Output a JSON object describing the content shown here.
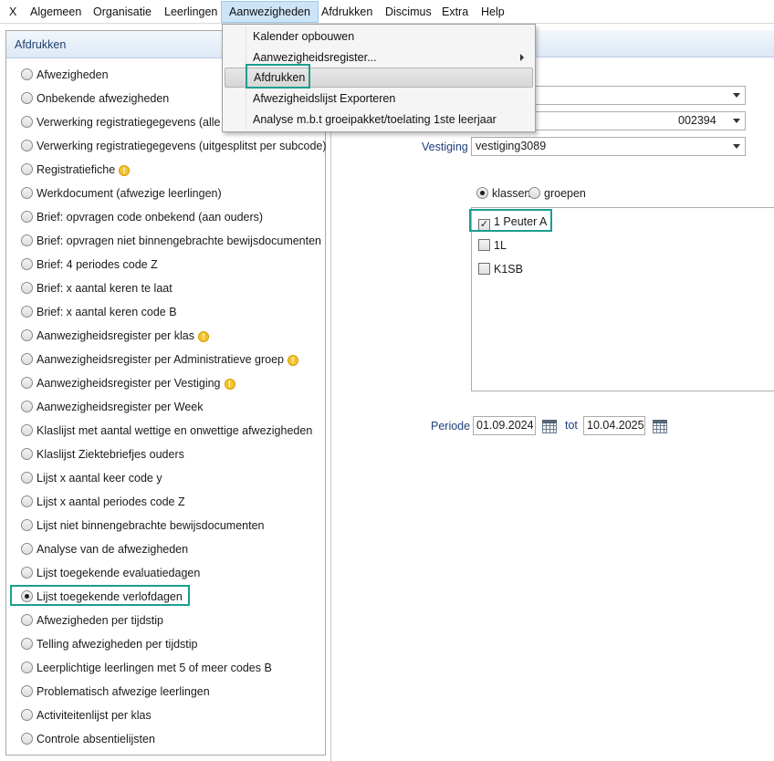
{
  "menubar": {
    "items": [
      "X",
      "Algemeen",
      "Organisatie",
      "Leerlingen",
      "Aanwezigheden",
      "Afdrukken",
      "Discimus",
      "Extra",
      "Help"
    ],
    "active": "Aanwezigheden"
  },
  "dropdown": {
    "items": [
      {
        "label": "Kalender opbouwen",
        "submenu": false
      },
      {
        "label": "Aanwezigheidsregister...",
        "submenu": true
      },
      {
        "label": "Afdrukken",
        "submenu": false,
        "hovered": true
      },
      {
        "label": "Afwezigheidslijst Exporteren",
        "submenu": false
      },
      {
        "label": "Analyse m.b.t groeipakket/toelating 1ste leerjaar",
        "submenu": false
      }
    ]
  },
  "left_panel": {
    "title": "Afdrukken",
    "options": [
      {
        "label": "Afwezigheden",
        "warn": false
      },
      {
        "label": "Onbekende afwezigheden",
        "warn": false
      },
      {
        "label": "Verwerking registratiegegevens (alle co",
        "warn": false
      },
      {
        "label": "Verwerking registratiegegevens (uitgesplitst per subcode)",
        "warn": false
      },
      {
        "label": "Registratiefiche",
        "warn": true
      },
      {
        "label": "Werkdocument (afwezige leerlingen)",
        "warn": false
      },
      {
        "label": "Brief: opvragen code onbekend (aan ouders)",
        "warn": false
      },
      {
        "label": "Brief: opvragen niet binnengebrachte bewijsdocumenten",
        "warn": false
      },
      {
        "label": "Brief: 4 periodes code Z",
        "warn": false
      },
      {
        "label": "Brief: x aantal keren te laat",
        "warn": false
      },
      {
        "label": "Brief: x aantal keren code B",
        "warn": false
      },
      {
        "label": "Aanwezigheidsregister per klas",
        "warn": true
      },
      {
        "label": "Aanwezigheidsregister per Administratieve groep",
        "warn": true
      },
      {
        "label": "Aanwezigheidsregister per Vestiging",
        "warn": true
      },
      {
        "label": "Aanwezigheidsregister per Week",
        "warn": false
      },
      {
        "label": "Klaslijst met aantal wettige en onwettige afwezigheden",
        "warn": false
      },
      {
        "label": "Klaslijst Ziektebriefjes ouders",
        "warn": false
      },
      {
        "label": "Lijst x aantal keer code y",
        "warn": false
      },
      {
        "label": "Lijst x aantal periodes code Z",
        "warn": false
      },
      {
        "label": "Lijst niet binnengebrachte bewijsdocumenten",
        "warn": false
      },
      {
        "label": "Analyse van de afwezigheden",
        "warn": false
      },
      {
        "label": "Lijst toegekende evaluatiedagen",
        "warn": false
      },
      {
        "label": "Lijst toegekende verlofdagen",
        "warn": false,
        "selected": true
      },
      {
        "label": "Afwezigheden per tijdstip",
        "warn": false
      },
      {
        "label": "Telling afwezigheden per tijdstip",
        "warn": false
      },
      {
        "label": "Leerplichtige leerlingen met 5 of meer codes B",
        "warn": false
      },
      {
        "label": "Problematisch afwezige leerlingen",
        "warn": false
      },
      {
        "label": "Activiteitenlijst per klas",
        "warn": false
      },
      {
        "label": "Controle absentielijsten",
        "warn": false
      }
    ]
  },
  "right_pane": {
    "combo1_value": "",
    "combo2_value": "002394",
    "vestiging_label": "Vestiging",
    "vestiging_value": "vestiging3089",
    "radio_klassen": "klassen",
    "radio_groepen": "groepen",
    "classes": [
      {
        "label": "1 Peuter A",
        "checked": true
      },
      {
        "label": "1L",
        "checked": false
      },
      {
        "label": "K1SB",
        "checked": false
      }
    ],
    "periode_label": "Periode",
    "date_from": "01.09.2024",
    "tot_label": "tot",
    "date_to": "10.04.2025"
  }
}
